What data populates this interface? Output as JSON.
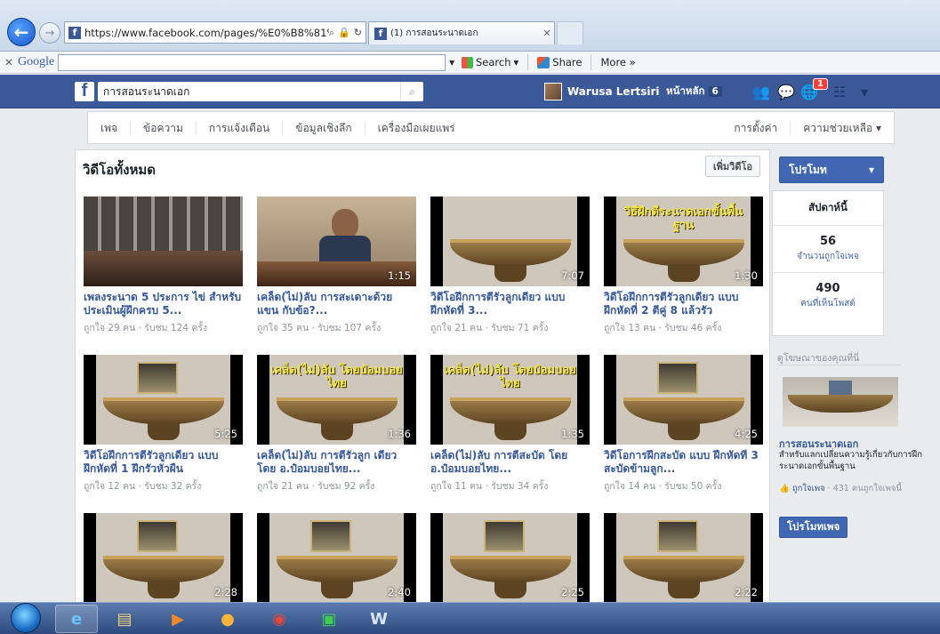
{
  "browser": {
    "address_url": "https://www.facebook.com/pages/%E0%B8%81%E",
    "tab_title": "(1) การสอนระนาดเอก"
  },
  "google_toolbar": {
    "logo": "Google",
    "search_label": "Search",
    "share_label": "Share",
    "more_label": "More »"
  },
  "fb_header": {
    "search_text": "การสอนระนาดเอก",
    "user_name": "Warusa Lertsiri",
    "home_label": "หน้าหลัก",
    "home_count": "6",
    "notification_count": "1"
  },
  "page_nav": {
    "items": [
      "เพจ",
      "ข้อความ",
      "การแจ้งเตือน",
      "ข้อมูลเชิงลึก",
      "เครื่องมือเผยแพร่"
    ],
    "settings": "การตั้งค่า",
    "help": "ความช่วยเหลือ ▾"
  },
  "videos": {
    "title": "วิดีโอทั้งหมด",
    "add_button": "เพิ่มวิดีโอ",
    "items": [
      {
        "title": "เพลงระนาด 5 ประการ ไข่ สำหรับประเมินผู้ฝึกครบ 5...",
        "meta": "ถูกใจ 29 คน · รับชม 124 ครั้ง",
        "duration": "0:54"
      },
      {
        "title": "เคล็ด(ไม่)ลับ การสะเดาะด้วย แขน กับข้อ?...",
        "meta": "ถูกใจ 35 คน · รับชม 107 ครั้ง",
        "duration": "1:15"
      },
      {
        "title": "วิดีโอฝึกการตีรัวลูกเดียว แบบฝึกหัดที่ 3...",
        "meta": "ถูกใจ 21 คน · รับชม 71 ครั้ง",
        "duration": "7:07"
      },
      {
        "title": "วิดีโอฝึกการตีรัวลูกเดียว แบบฝึกหัดที่ 2 ตีคู่ 8 แล้วรัว",
        "meta": "ถูกใจ 13 คน · รับชม 46 ครั้ง",
        "duration": "1:30",
        "caption": "วิธีฝึกตีระนาดเอกขั้นพื้นฐาน"
      },
      {
        "title": "วิดีโอฝึกการตีรัวลูกเดียว แบบฝึกหัดที่ 1 ฝึกรัวหัวผืน",
        "meta": "ถูกใจ 12 คน · รับชม 32 ครั้ง",
        "duration": "5:25"
      },
      {
        "title": "เคล็ด(ไม่)ลับ การตีรัวลูก เดียว โดย อ.ป๋อมบอยไทย...",
        "meta": "ถูกใจ 21 คน · รับชม 92 ครั้ง",
        "duration": "1:36",
        "caption": "เคล็ด(ไม่)ลับ โดยป๋อมบอยไทย"
      },
      {
        "title": "เคล็ด(ไม่)ลับ การตีสะบัด โดย อ.ป๋อมบอยไทย...",
        "meta": "ถูกใจ 11 คน · รับชม 34 ครั้ง",
        "duration": "1:35",
        "caption": "เคล็ด(ไม่)ลับ โดยป๋อมบอยไทย"
      },
      {
        "title": "วิดีโอการฝึกสะบัด แบบ ฝึกหัดที่ 3 สะบัดข้ามลูก...",
        "meta": "ถูกใจ 14 คน · รับชม 50 ครั้ง",
        "duration": "4:25"
      },
      {
        "title": "",
        "meta": "",
        "duration": "2:28"
      },
      {
        "title": "",
        "meta": "",
        "duration": "2:40"
      },
      {
        "title": "",
        "meta": "",
        "duration": "2:25"
      },
      {
        "title": "",
        "meta": "",
        "duration": "2:22"
      }
    ]
  },
  "sidebar": {
    "promote": "โปรโมท",
    "week_label": "สัปดาห์นี้",
    "stats": [
      {
        "value": "56",
        "label": "จำนวนถูกใจเพจ"
      },
      {
        "value": "490",
        "label": "คนที่เห็นโพสต์"
      }
    ],
    "ads_header": "ดูโฆษณาของคุณที่นี่",
    "ad_title": "การสอนระนาดเอก",
    "ad_desc": "สำหรับแลกเปลี่ยนความรู้เกี่ยวกับการฝึกระนาดเอกขั้นพื้นฐาน",
    "ad_like_link": "ถูกใจเพจ",
    "ad_like_count": " · 431 คนถูกใจเพจนี้",
    "promote_page": "โปรโมทเพจ"
  }
}
